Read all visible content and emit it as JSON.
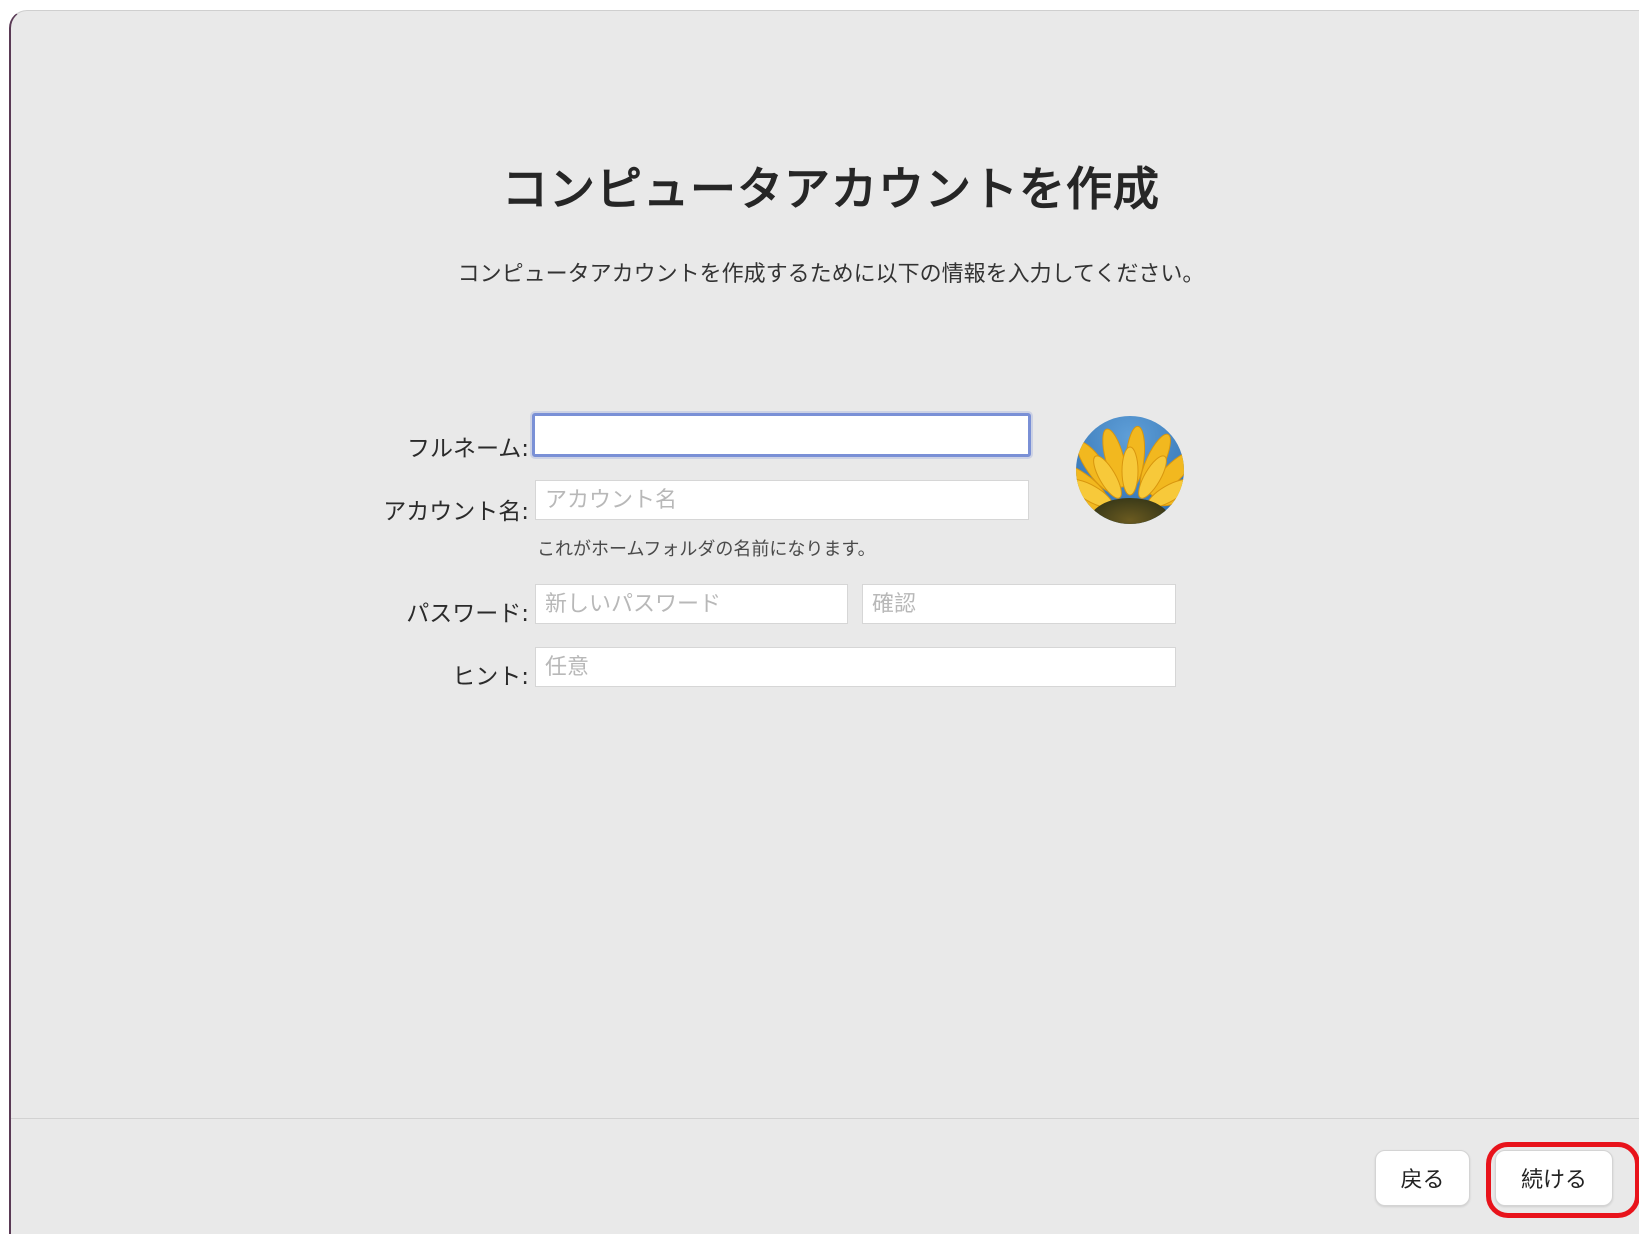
{
  "header": {
    "title": "コンピュータアカウントを作成",
    "subtitle": "コンピュータアカウントを作成するために以下の情報を入力してください。"
  },
  "form": {
    "full_name": {
      "label": "フルネーム:",
      "value": "",
      "placeholder": ""
    },
    "account_name": {
      "label": "アカウント名:",
      "value": "",
      "placeholder": "アカウント名",
      "note": "これがホームフォルダの名前になります。"
    },
    "password": {
      "label": "パスワード:",
      "placeholder": "新しいパスワード",
      "confirm_placeholder": "確認"
    },
    "hint": {
      "label": "ヒント:",
      "placeholder": "任意"
    }
  },
  "avatar": {
    "icon": "sunflower-picture"
  },
  "footer": {
    "back_label": "戻る",
    "continue_label": "続ける"
  },
  "colors": {
    "focus_ring": "#7a90d6",
    "highlight": "#e8131b",
    "background": "#e9e9e9"
  }
}
